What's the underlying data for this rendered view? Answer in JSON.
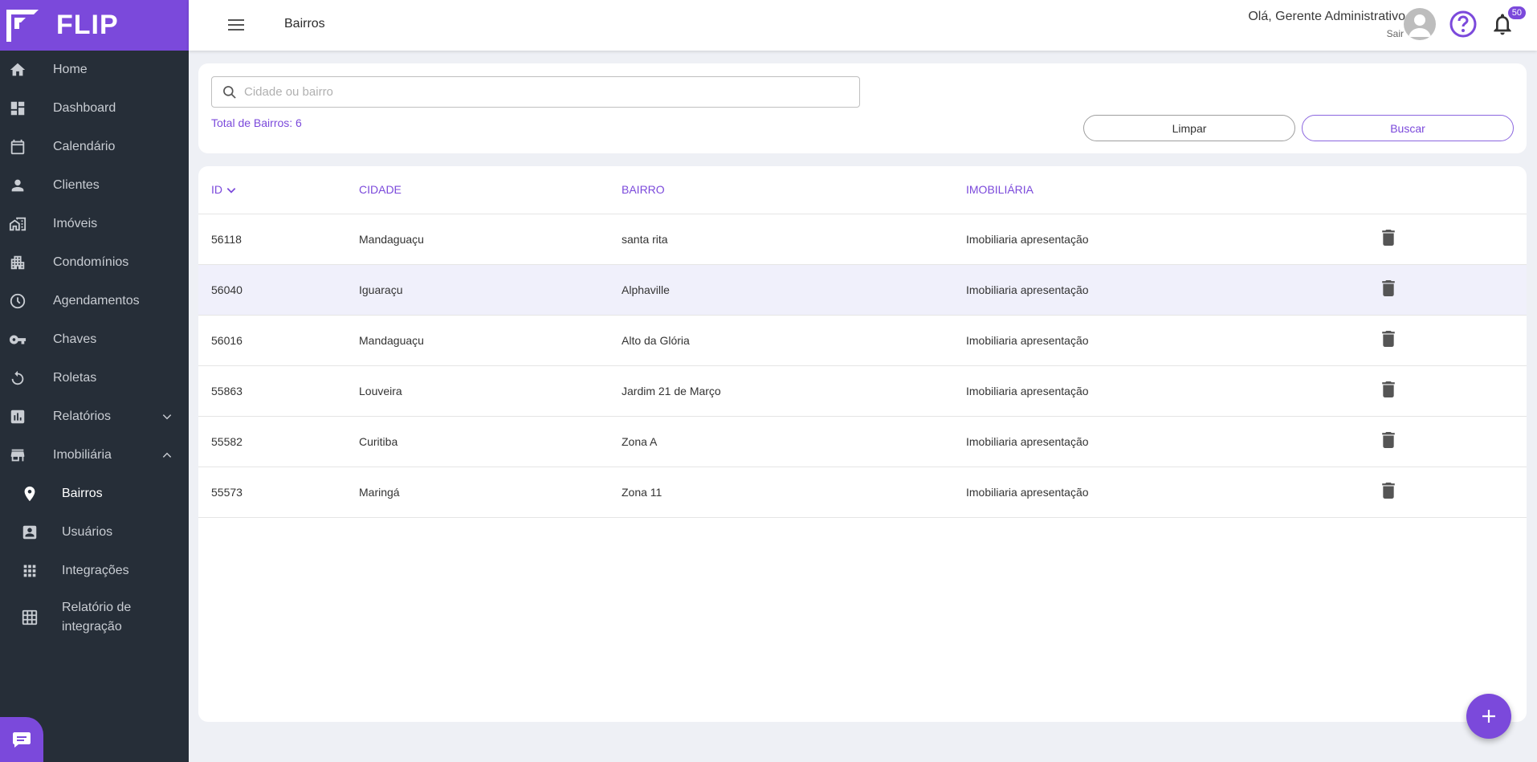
{
  "brand": {
    "name": "FLIP"
  },
  "sidebar": {
    "items": [
      {
        "label": "Home",
        "icon": "home-icon"
      },
      {
        "label": "Dashboard",
        "icon": "dashboard-icon"
      },
      {
        "label": "Calendário",
        "icon": "calendar-icon"
      },
      {
        "label": "Clientes",
        "icon": "person-icon"
      },
      {
        "label": "Imóveis",
        "icon": "building-icon"
      },
      {
        "label": "Condomínios",
        "icon": "apartment-icon"
      },
      {
        "label": "Agendamentos",
        "icon": "clock-icon"
      },
      {
        "label": "Chaves",
        "icon": "key-icon"
      },
      {
        "label": "Roletas",
        "icon": "rotate-icon"
      },
      {
        "label": "Relatórios",
        "icon": "report-icon"
      },
      {
        "label": "Imobiliária",
        "icon": "store-icon"
      }
    ],
    "subitems": [
      {
        "label": "Bairros",
        "icon": "location-pin-icon"
      },
      {
        "label": "Usuários",
        "icon": "user-card-icon"
      },
      {
        "label": "Integrações",
        "icon": "apps-grid-icon"
      },
      {
        "label": "Relatório de integração",
        "icon": "table-grid-icon"
      }
    ]
  },
  "header": {
    "title": "Bairros",
    "greeting": "Olá, Gerente Administrativo",
    "logout": "Sair",
    "notifications": "50"
  },
  "filter": {
    "placeholder": "Cidade ou bairro",
    "total_label": "Total de Bairros: 6",
    "clear_label": "Limpar",
    "search_label": "Buscar"
  },
  "table": {
    "columns": [
      "ID",
      "CIDADE",
      "BAIRRO",
      "IMOBILIÁRIA"
    ],
    "rows": [
      {
        "id": "56118",
        "cidade": "Mandaguaçu",
        "bairro": "santa rita",
        "imobiliaria": "Imobiliaria apresentação"
      },
      {
        "id": "56040",
        "cidade": "Iguaraçu",
        "bairro": "Alphaville",
        "imobiliaria": "Imobiliaria apresentação"
      },
      {
        "id": "56016",
        "cidade": "Mandaguaçu",
        "bairro": "Alto da Glória",
        "imobiliaria": "Imobiliaria apresentação"
      },
      {
        "id": "55863",
        "cidade": "Louveira",
        "bairro": "Jardim 21 de Março",
        "imobiliaria": "Imobiliaria apresentação"
      },
      {
        "id": "55582",
        "cidade": "Curitiba",
        "bairro": "Zona A",
        "imobiliaria": "Imobiliaria apresentação"
      },
      {
        "id": "55573",
        "cidade": "Maringá",
        "bairro": "Zona 11",
        "imobiliaria": "Imobiliaria apresentação"
      }
    ]
  },
  "colors": {
    "accent": "#7b49db",
    "sidebar_bg": "#262e38",
    "row_highlight": "#f0f0fb"
  }
}
